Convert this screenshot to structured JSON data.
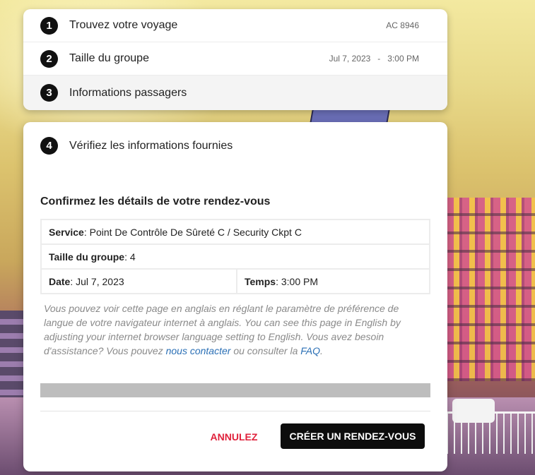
{
  "steps": [
    {
      "num": "1",
      "title": "Trouvez votre voyage",
      "meta": [
        "AC 8946"
      ]
    },
    {
      "num": "2",
      "title": "Taille du groupe",
      "meta": [
        "Jul 7, 2023",
        "-",
        "3:00 PM"
      ]
    },
    {
      "num": "3",
      "title": "Informations passagers"
    }
  ],
  "current_step": {
    "num": "4",
    "title": "Vérifiez les informations fournies"
  },
  "confirm": {
    "heading": "Confirmez les détails de votre rendez-vous",
    "service_label": "Service",
    "service_value": ": Point De Contrôle De Sûreté C / Security Ckpt C",
    "group_label": "Taille du groupe",
    "group_value": ": 4",
    "date_label": "Date",
    "date_value": ": Jul 7, 2023",
    "time_label": "Temps",
    "time_value": ": 3:00 PM"
  },
  "note": {
    "text_before": "Vous pouvez voir cette page en anglais en réglant le paramètre de préférence de langue de votre navigateur internet à anglais. You can see this page in English by adjusting your internet browser language setting to English. Vous avez besoin d'assistance? Vous pouvez ",
    "contact_link": "nous contacter",
    "text_middle": " ou consulter la ",
    "faq_link": "FAQ",
    "text_after": "."
  },
  "buttons": {
    "cancel": "ANNULEZ",
    "create": "CRÉER UN RENDEZ-VOUS"
  },
  "colors": {
    "cancel_text": "#e0213b",
    "primary_button": "#0d0d0d",
    "link": "#2a6fb5"
  }
}
